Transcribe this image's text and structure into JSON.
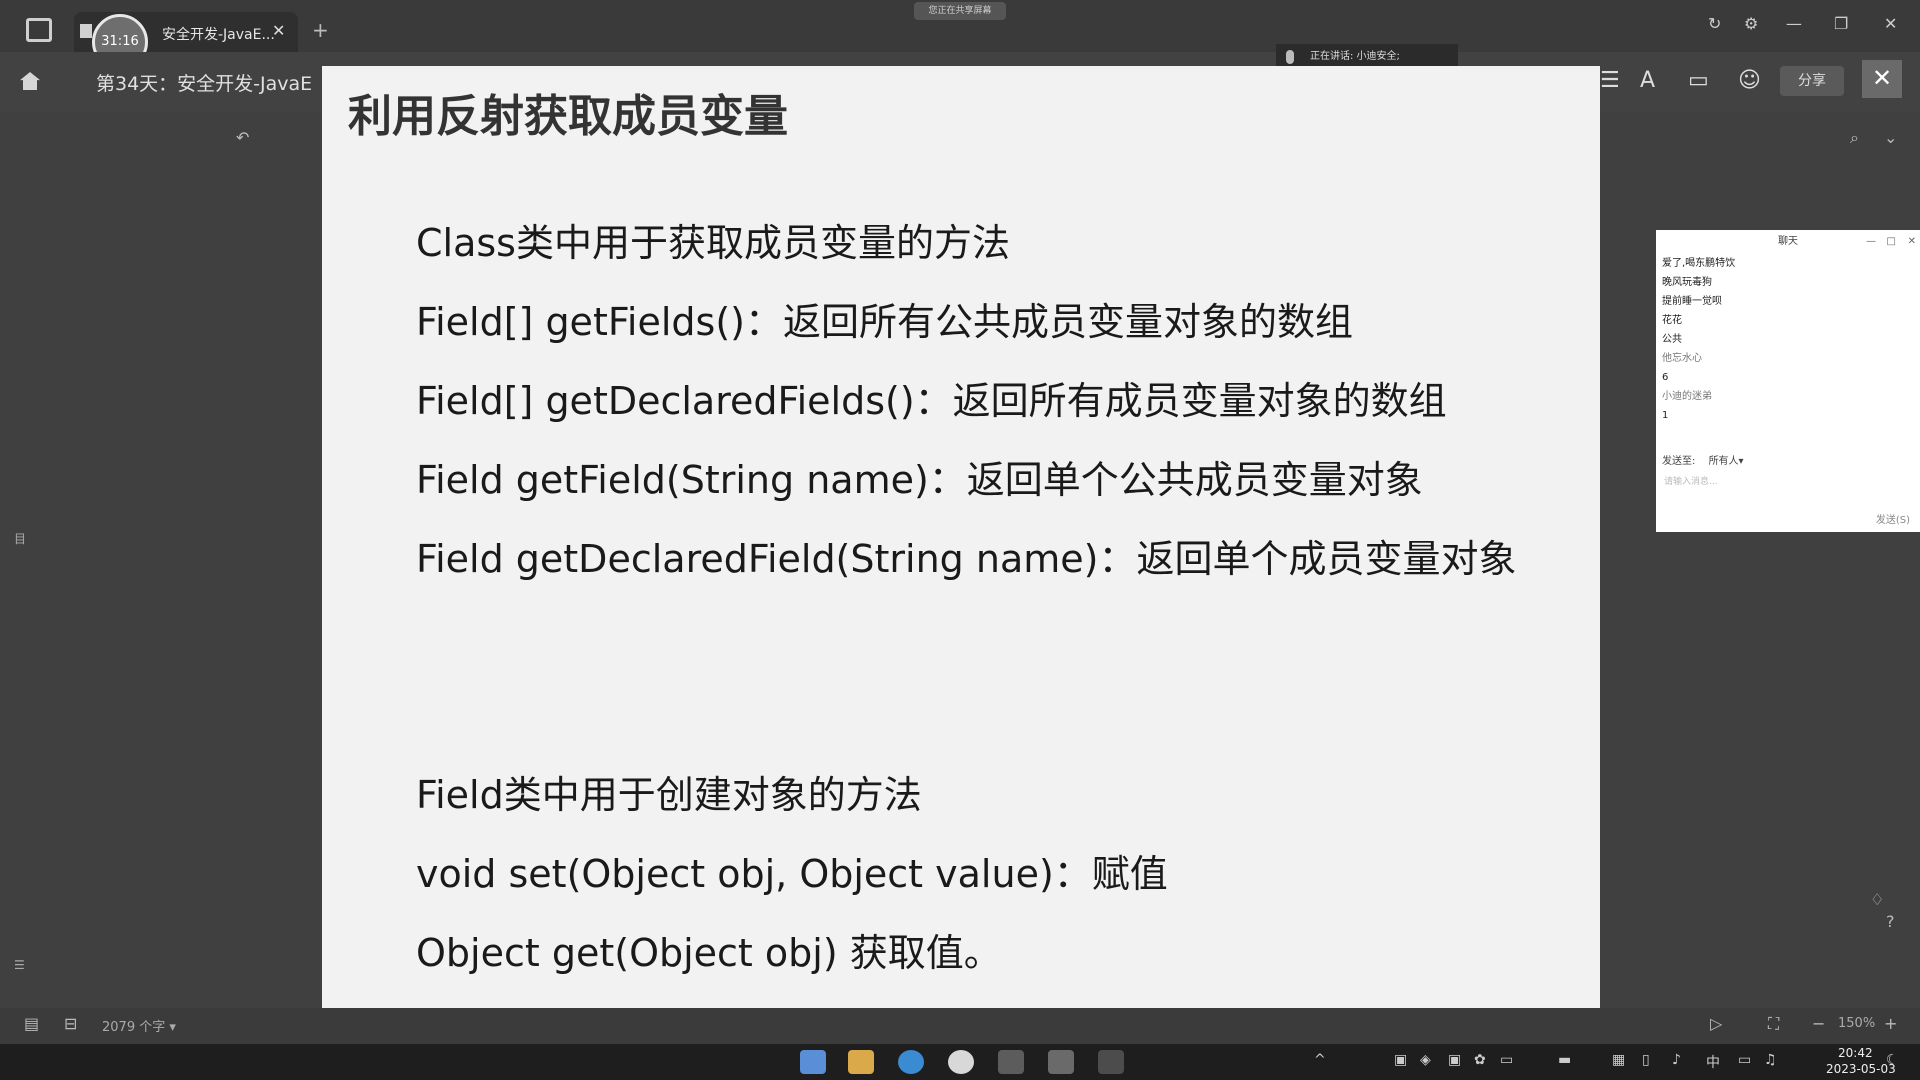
{
  "titlebar": {
    "timer": "31:16",
    "tab_label": "安全开发-JavaE...",
    "tab_close": "✕",
    "tab_add": "+",
    "share_banner": "您正在共享屏幕"
  },
  "toolbar": {
    "doc_title": "第34天：安全开发-JavaE",
    "mic_status": "正在讲话: 小迪安全;",
    "share_label": "分享",
    "close_label": "✕"
  },
  "slide": {
    "title": "利用反射获取成员变量",
    "lines": [
      "Class类中用于获取成员变量的方法",
      "Field[] getFields()：返回所有公共成员变量对象的数组",
      "Field[] getDeclaredFields()：返回所有成员变量对象的数组",
      "Field getField(String name)：返回单个公共成员变量对象",
      "Field getDeclaredField(String name)：返回单个成员变量对象",
      "Field类中用于创建对象的方法",
      "void set(Object obj, Object value)：赋值",
      "Object get(Object obj) 获取值。"
    ]
  },
  "chat": {
    "title": "聊天",
    "messages": [
      "爱了,喝东鹏特饮",
      "晚风玩毒狗",
      "提前睡一觉呗",
      "花花",
      "公共",
      "他忘水心",
      "6",
      "小迪的迷弟",
      "1"
    ],
    "send_to_label": "发送至:",
    "send_to_value": "所有人▾",
    "input_placeholder": "请输入消息...",
    "send_label": "发送(S)"
  },
  "statusbar": {
    "word_count": "2079 个字 ▾",
    "zoom": "150%"
  },
  "taskbar": {
    "time": "20:42",
    "date": "2023-05-03",
    "ime": "中"
  }
}
